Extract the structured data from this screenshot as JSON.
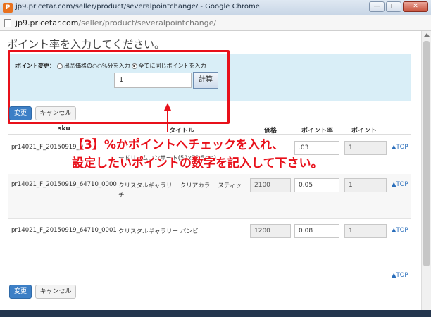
{
  "window": {
    "title": "jp9.pricetar.com/seller/product/severalpointchange/ - Google Chrome",
    "controls": [
      "minimize",
      "maximize",
      "close"
    ],
    "app_icon": "P"
  },
  "address": {
    "host": "jp9.pricetar.com",
    "path": "/seller/product/severalpointchange/"
  },
  "page": {
    "title": "ポイント率を入力してください。"
  },
  "point_change": {
    "label": "ポイント変更：",
    "option_percent": "出品価格の○○%分を入力",
    "option_same": "全てに同じポイントを入力",
    "selected": "same",
    "input_value": "1",
    "calc_button": "計算"
  },
  "actions": {
    "save": "変更",
    "cancel": "キャンセル"
  },
  "table": {
    "headers": {
      "sku": "sku",
      "title": "タイトル",
      "price": "価格",
      "rate": "ポイント率",
      "point": "ポイント"
    },
    "rows": [
      {
        "sku": "pr14021_F_20150919_0",
        "title": "ードリームコンサート(51x73.5cm)",
        "price": "",
        "rate": ".03",
        "point": "1",
        "top": "▲TOP"
      },
      {
        "sku": "pr14021_F_20150919_64710_0000",
        "title": "クリスタルギャラリー クリアカラー スティッチ",
        "price": "2100",
        "rate": "0.05",
        "point": "1",
        "top": "▲TOP"
      },
      {
        "sku": "pr14021_F_20150919_64710_0001",
        "title": "クリスタルギャラリー バンビ",
        "price": "1200",
        "rate": "0.08",
        "point": "1",
        "top": "▲TOP"
      }
    ],
    "footer_top": "▲TOP"
  },
  "annotation": {
    "line1": "【3】%かポイントへチェックを入れ、",
    "line2": "設定したいポイントの数字を記入して下さい。",
    "color": "#e8101a"
  }
}
